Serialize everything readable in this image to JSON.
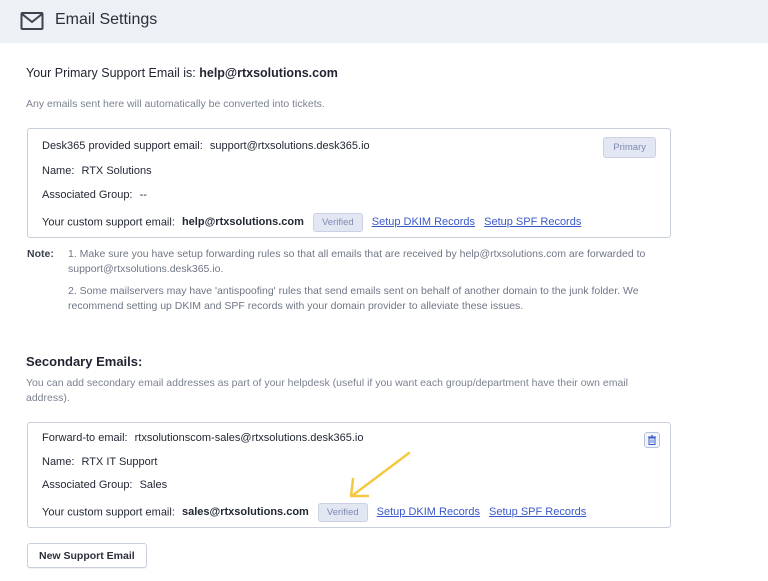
{
  "header": {
    "title": "Email Settings",
    "icon": "mail-icon"
  },
  "primary": {
    "label": "Your Primary Support Email is:",
    "email": "help@rtxsolutions.com",
    "note": "Any emails sent here will automatically be converted into tickets."
  },
  "card1": {
    "provided_label": "Desk365 provided support email:",
    "provided_value": "support@rtxsolutions.desk365.io",
    "badge": "Primary",
    "name_label": "Name:",
    "name_value": "RTX Solutions",
    "group_label": "Associated Group:",
    "group_value": "--",
    "custom_label": "Your custom support email:",
    "custom_value": "help@rtxsolutions.com",
    "verified": "Verified",
    "dkim_link": "Setup DKIM Records",
    "spf_link": "Setup SPF Records"
  },
  "notes": {
    "label": "Note:",
    "items": [
      "1. Make sure you have setup forwarding rules so that all emails that are received by help@rtxsolutions.com are forwarded to support@rtxsolutions.desk365.io.",
      "2. Some mailservers may have 'antispoofing' rules that send emails sent on behalf of another domain to the junk folder. We recommend setting up DKIM and SPF records with your domain provider to alleviate these issues."
    ]
  },
  "secondary": {
    "title": "Secondary Emails:",
    "desc": "You can add secondary email addresses as part of your helpdesk (useful if you want each group/department have their own email address)."
  },
  "card2": {
    "forward_label": "Forward-to email:",
    "forward_value": "rtxsolutionscom-sales@rtxsolutions.desk365.io",
    "name_label": "Name:",
    "name_value": "RTX IT Support",
    "group_label": "Associated Group:",
    "group_value": "Sales",
    "custom_label": "Your custom support email:",
    "custom_value": "sales@rtxsolutions.com",
    "verified": "Verified",
    "dkim_link": "Setup DKIM Records",
    "spf_link": "Setup SPF Records"
  },
  "new_button": "New Support Email",
  "colors": {
    "accent_link": "#3b59c9",
    "header_bg": "#edf0f4",
    "annotation_arrow": "#f5c842"
  }
}
